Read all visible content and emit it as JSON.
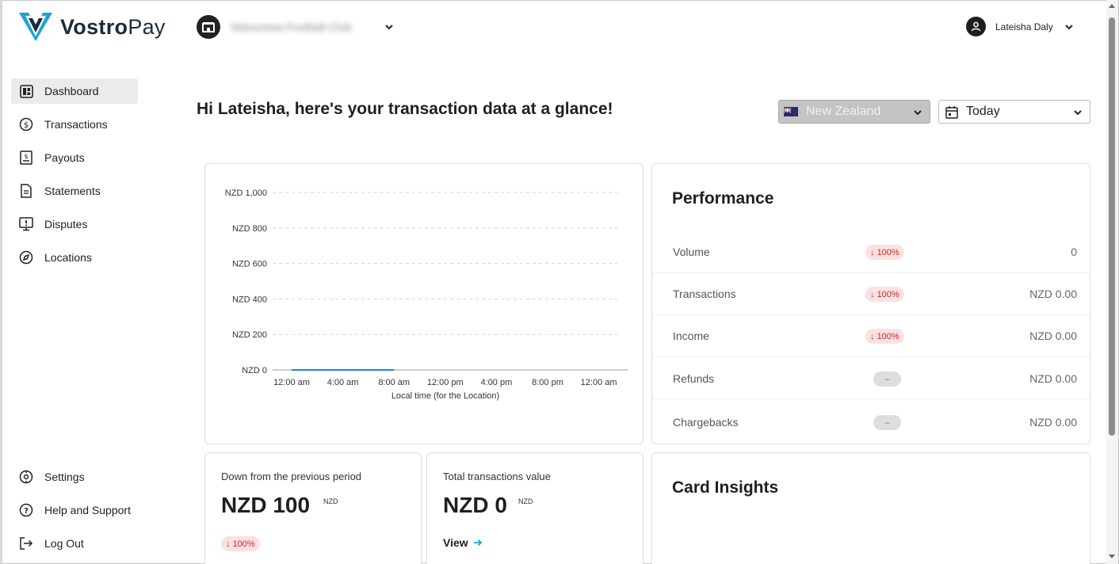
{
  "brand": {
    "name_bold": "Vostro",
    "name_light": "Pay",
    "accent": "#1aa3d9",
    "dark": "#1c2b3a"
  },
  "header": {
    "club_name": "Manurewa Football Club",
    "user_name": "Lateisha Daly"
  },
  "sidebar": {
    "items": [
      {
        "label": "Dashboard",
        "icon": "dashboard-icon",
        "active": true
      },
      {
        "label": "Transactions",
        "icon": "dollar-circle-icon"
      },
      {
        "label": "Payouts",
        "icon": "payout-icon"
      },
      {
        "label": "Statements",
        "icon": "document-icon"
      },
      {
        "label": "Disputes",
        "icon": "alert-monitor-icon"
      },
      {
        "label": "Locations",
        "icon": "location-icon"
      }
    ],
    "bottom": [
      {
        "label": "Settings",
        "icon": "gear-icon"
      },
      {
        "label": "Help and Support",
        "icon": "help-icon"
      },
      {
        "label": "Log Out",
        "icon": "logout-icon"
      }
    ]
  },
  "main": {
    "greeting": "Hi Lateisha, here's your transaction data at a glance!",
    "country_select": "New Zealand",
    "date_select": "Today"
  },
  "chart_data": {
    "type": "line",
    "y_ticks": [
      "NZD 1,000",
      "NZD 800",
      "NZD 600",
      "NZD 400",
      "NZD 200",
      "NZD 0"
    ],
    "x_ticks": [
      "12:00 am",
      "4:00 am",
      "8:00 am",
      "12:00 pm",
      "4:00 pm",
      "8:00 pm",
      "12:00 am"
    ],
    "xlabel": "Local time (for the Location)",
    "ylim": [
      0,
      1000
    ],
    "series": [
      {
        "x": [
          "12:00 am",
          "4:00 am",
          "8:00 am"
        ],
        "values": [
          0,
          0,
          0
        ],
        "color": "#1e88e5"
      }
    ],
    "grid": true
  },
  "performance": {
    "title": "Performance",
    "rows": [
      {
        "label": "Volume",
        "badge": "100%",
        "trend": "down",
        "value": "0"
      },
      {
        "label": "Transactions",
        "badge": "100%",
        "trend": "down",
        "value": "NZD 0.00"
      },
      {
        "label": "Income",
        "badge": "100%",
        "trend": "down",
        "value": "NZD 0.00"
      },
      {
        "label": "Refunds",
        "badge": "–",
        "trend": "none",
        "value": "NZD 0.00"
      },
      {
        "label": "Chargebacks",
        "badge": "–",
        "trend": "none",
        "value": "NZD 0.00"
      }
    ]
  },
  "stats": {
    "previous": {
      "label": "Down from the previous period",
      "value": "NZD 100",
      "unit": "NZD",
      "badge": "100%"
    },
    "total": {
      "label": "Total transactions value",
      "value": "NZD 0",
      "unit": "NZD",
      "link": "View"
    }
  },
  "card_insights": {
    "title": "Card Insights"
  }
}
